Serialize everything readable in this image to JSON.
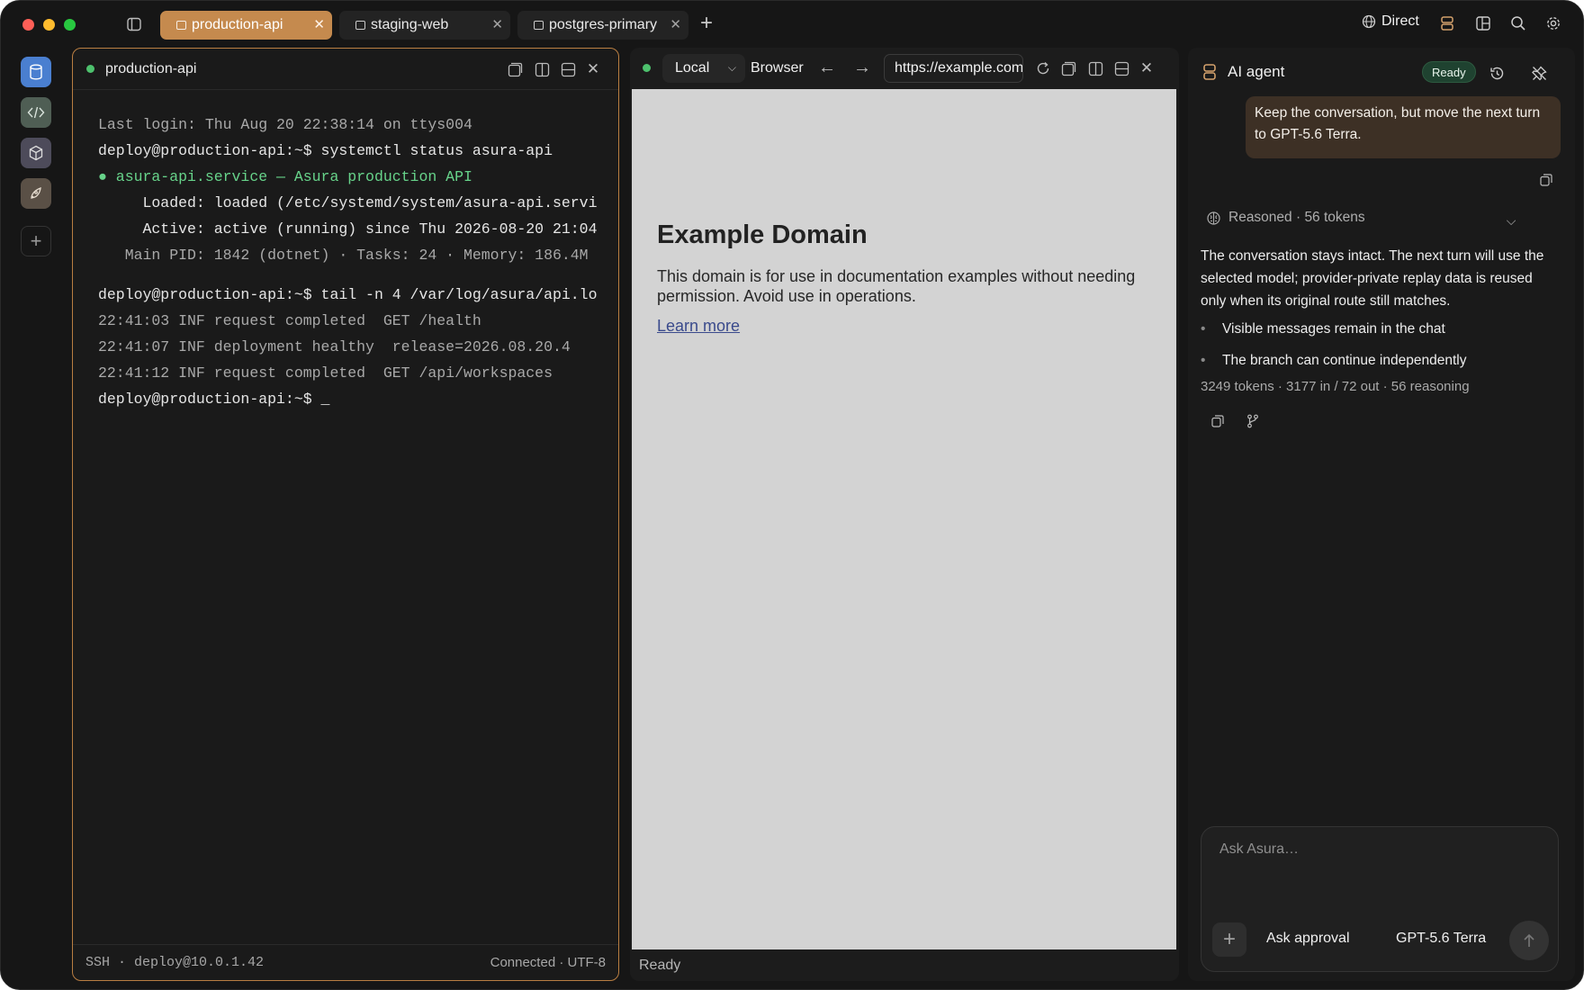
{
  "titlebar": {
    "tabs": [
      {
        "label": "production-api",
        "active": true
      },
      {
        "label": "staging-web",
        "active": false
      },
      {
        "label": "postgres-primary",
        "active": false
      }
    ],
    "connection_mode": "Direct"
  },
  "terminal": {
    "title": "production-api",
    "status_color": "#4dc16d",
    "lines": {
      "l1": "Last login: Thu Aug 20 22:38:14 on ttys004",
      "l2": "deploy@production-api:~$ systemctl status asura-api",
      "l3": "● asura-api.service — Asura production API",
      "l4": "     Loaded: loaded (/etc/systemd/system/asura-api.servi",
      "l5": "     Active: active (running) since Thu 2026-08-20 21:04",
      "l6": "   Main PID: 1842 (dotnet) · Tasks: 24 · Memory: 186.4M",
      "l7": "deploy@production-api:~$ tail -n 4 /var/log/asura/api.lo",
      "l8": "22:41:03 INF request completed  GET /health",
      "l9": "22:41:07 INF deployment healthy  release=2026.08.20.4",
      "l10": "22:41:12 INF request completed  GET /api/workspaces",
      "l11": "deploy@production-api:~$ _"
    },
    "footer_left": "SSH · deploy@10.0.1.42",
    "footer_right": "Connected · UTF-8"
  },
  "browser": {
    "target": "Local",
    "label": "Browser",
    "url": "https://example.com",
    "page": {
      "title": "Example Domain",
      "body": "This domain is for use in documentation examples without needing permission. Avoid use in operations.",
      "link": "Learn more"
    },
    "status": "Ready"
  },
  "agent": {
    "title": "AI agent",
    "status": "Ready",
    "user_message": "Keep the conversation, but move the next turn to GPT-5.6 Terra.",
    "reasoning_summary": "Reasoned · 56 tokens",
    "answer": "The conversation stays intact. The next turn will use the selected model; provider-private replay data is reused only when its original route still matches.",
    "bullets": [
      "Visible messages remain in the chat",
      "The branch can continue independently"
    ],
    "usage": "3249 tokens · 3177 in / 72 out · 56 reasoning",
    "composer": {
      "placeholder": "Ask Asura…",
      "approval": "Ask approval",
      "model": "GPT-5.6 Terra"
    }
  },
  "colors": {
    "accent": "#c58a4e",
    "terminal_green": "#67d38a",
    "ready_badge": "#1f4230"
  }
}
